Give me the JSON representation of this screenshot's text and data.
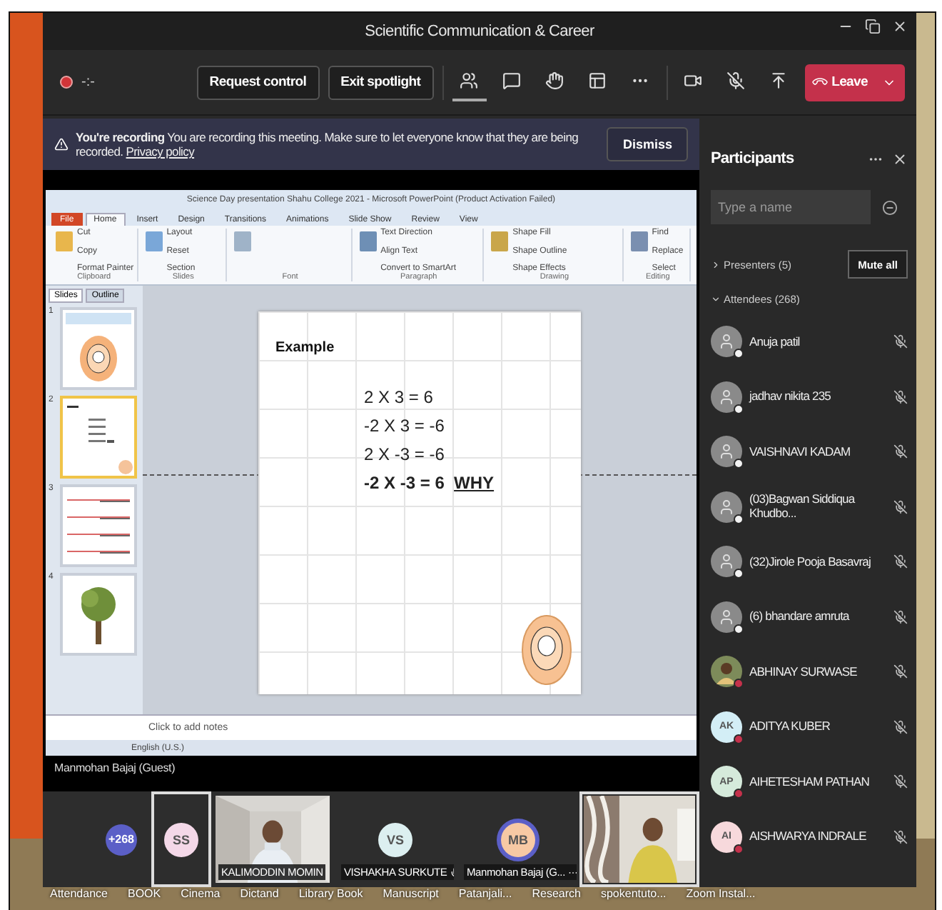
{
  "window": {
    "title": "Scientific Communication & Career"
  },
  "meeting_bar": {
    "recording": true,
    "timer": "-:-",
    "buttons": [
      "Request control",
      "Exit spotlight"
    ],
    "tools": [
      {
        "kind": "people",
        "selected": true
      },
      {
        "kind": "chat",
        "selected": false
      },
      {
        "kind": "hand",
        "selected": false
      },
      {
        "kind": "rooms",
        "selected": false
      },
      {
        "kind": "more",
        "selected": false
      }
    ],
    "devices": [
      {
        "kind": "camera"
      },
      {
        "kind": "mic-off"
      },
      {
        "kind": "share"
      }
    ],
    "leave": "Leave"
  },
  "recording_banner": {
    "title": "You're recording",
    "message": "You are recording this meeting. Make sure to let everyone know that they are being recorded.",
    "link": "Privacy policy",
    "dismiss": "Dismiss"
  },
  "presentation": {
    "app_title": "Science Day presentation Shahu College 2021 - Microsoft PowerPoint (Product Activation Failed)",
    "ribbon_tabs": [
      {
        "label": "File",
        "kind": "file",
        "selected": false
      },
      {
        "label": "Home",
        "kind": "tab",
        "selected": true
      },
      {
        "label": "Insert",
        "kind": "tab",
        "selected": false
      },
      {
        "label": "Design",
        "kind": "tab",
        "selected": false
      },
      {
        "label": "Transitions",
        "kind": "tab",
        "selected": false
      },
      {
        "label": "Animations",
        "kind": "tab",
        "selected": false
      },
      {
        "label": "Slide Show",
        "kind": "tab",
        "selected": false
      },
      {
        "label": "Review",
        "kind": "tab",
        "selected": false
      },
      {
        "label": "View",
        "kind": "tab",
        "selected": false
      }
    ],
    "ribbon_groups": [
      {
        "label": "Clipboard",
        "commands": [
          "Cut",
          "Copy",
          "Format Painter"
        ]
      },
      {
        "label": "Slides",
        "commands": [
          "Layout",
          "Reset",
          "Section"
        ]
      },
      {
        "label": "Font"
      },
      {
        "label": "Paragraph",
        "commands": [
          "Text Direction",
          "Align Text",
          "Convert to SmartArt"
        ]
      },
      {
        "label": "Drawing",
        "commands": [
          "Shape Fill",
          "Shape Outline",
          "Shape Effects"
        ]
      },
      {
        "label": "Editing",
        "commands": [
          "Find",
          "Replace",
          "Select"
        ]
      }
    ],
    "pane_tabs": [
      {
        "label": "Slides",
        "selected": true
      },
      {
        "label": "Outline",
        "selected": false
      }
    ],
    "thumbnails": [
      {
        "number": "1",
        "kind": "circle",
        "selected": false
      },
      {
        "number": "2",
        "kind": "text",
        "selected": true
      },
      {
        "number": "3",
        "kind": "lines",
        "selected": false
      },
      {
        "number": "4",
        "kind": "tree",
        "selected": false
      }
    ],
    "slide": {
      "title": "Example",
      "lines": [
        {
          "text": "2 X 3 = 6",
          "bold": false
        },
        {
          "text": "-2 X 3 = -6",
          "bold": false
        },
        {
          "text": "2 X -3 = -6",
          "bold": false
        },
        {
          "text": "-2 X -3 = 6",
          "bold": true,
          "tag": "WHY"
        }
      ]
    },
    "notes_placeholder": "Click to add notes",
    "status": "English (U.S.)",
    "presenter": "Manmohan Bajaj (Guest)"
  },
  "participants": {
    "title": "Participants",
    "search_placeholder": "Type a name",
    "presenters": {
      "label": "Presenters (5)",
      "expanded": false
    },
    "mute_all": "Mute all",
    "attendees": {
      "label": "Attendees (268)",
      "expanded": true
    },
    "people": [
      {
        "name": "Anuja patil",
        "kind": "generic",
        "color": "#f2f2f2"
      },
      {
        "name": "jadhav nikita 235",
        "kind": "generic",
        "color": "#f2f2f2"
      },
      {
        "name": "VAISHNAVI KADAM",
        "kind": "generic",
        "color": "#f2f2f2"
      },
      {
        "name": "(03)Bagwan Siddiqua Khudbo...",
        "kind": "generic",
        "color": "#f2f2f2"
      },
      {
        "name": "(32)Jirole Pooja Basavraj",
        "kind": "generic",
        "color": "#f2f2f2"
      },
      {
        "name": "(6) bhandare amruta",
        "kind": "generic",
        "color": "#f2f2f2"
      },
      {
        "name": "ABHINAY SURWASE",
        "color": "#c4314b"
      },
      {
        "name": "ADITYA KUBER",
        "kind": "initials",
        "avatar": {
          "initials": "AK",
          "color": "#d3eef6"
        },
        "color": "#c4314b"
      },
      {
        "name": "AIHETESHAM PATHAN",
        "kind": "initials",
        "avatar": {
          "initials": "AP",
          "color": "#d5eadb"
        },
        "color": "#c4314b"
      },
      {
        "name": "AISHWARYA INDRALE",
        "kind": "initials",
        "avatar": {
          "initials": "AI",
          "color": "#f7d9dc"
        },
        "color": "#c4314b"
      }
    ]
  },
  "videos": [
    {
      "kind": "overflow",
      "text": "+268",
      "selected": false
    },
    {
      "kind": "initials",
      "text": "SS",
      "color": "#f4d8e8",
      "selected": true,
      "speaking": false
    },
    {
      "kind": "video",
      "name": "KALIMODDIN MOMIN",
      "selected": false
    },
    {
      "kind": "initials",
      "text": "VS",
      "color": "#dceff0",
      "name": "VISHAKHA SURKUTE",
      "mic": true,
      "selected": false,
      "speaking": false
    },
    {
      "kind": "initials",
      "text": "MB",
      "color": "#f7c9a4",
      "name": "Manmohan Bajaj (G...",
      "more": "···",
      "selected": false,
      "speaking": true
    },
    {
      "kind": "video",
      "selected": true
    }
  ],
  "desktop_icons": [
    "Attendance",
    "BOOK",
    "Cinema",
    "Dictand",
    "Library Book",
    "Manuscript",
    "Patanjali...",
    "Research",
    "spokentuto...",
    "Zoom Instal..."
  ]
}
